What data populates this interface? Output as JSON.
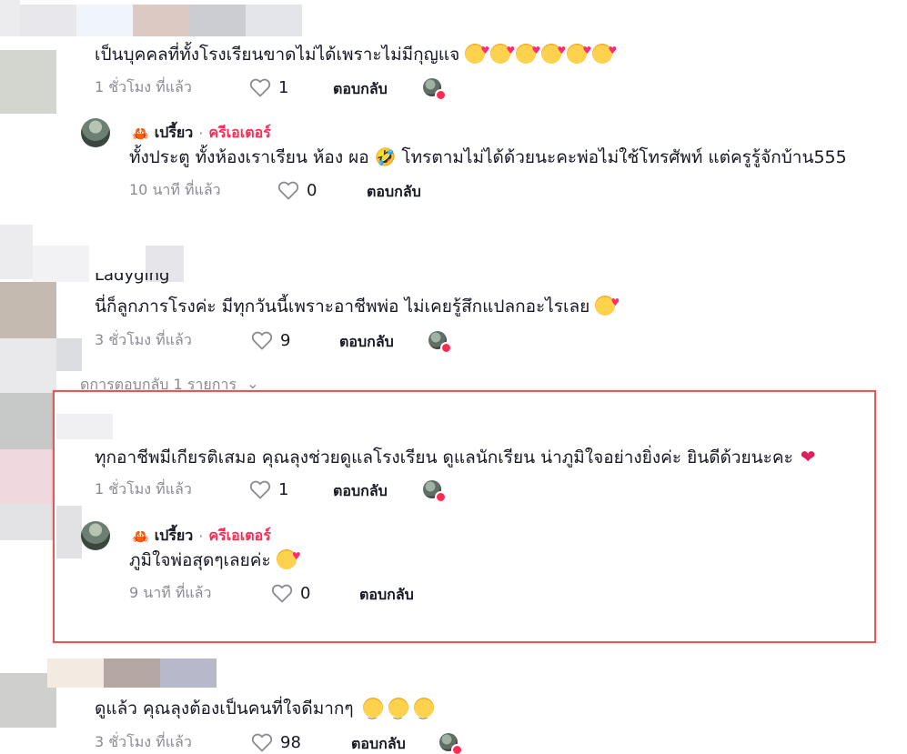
{
  "comments": [
    {
      "text": "เป็นบุคคลที่ทั้งโรงเรียนขาดไม่ได้เพราะไม่มีกุญแจ",
      "emojis": [
        "love",
        "love",
        "love",
        "love",
        "love",
        "love"
      ],
      "time": "1 ชั่วโมง ที่แล้ว",
      "likes": "1",
      "reply_label": "ตอบกลับ"
    },
    {
      "author_prefix": "🦀",
      "author": "เปรี้ยว",
      "separator": "·",
      "role": "ครีเอเตอร์",
      "text": "ทั้งประตู ทั้งห้องเราเรียน ห้อง ผอ 🤣 โทรตามไม่ได้ด้วยนะคะพ่อไม่ใช้โทรศัพท์ แต่ครูรู้จักบ้าน555",
      "time": "10 นาที ที่แล้ว",
      "likes": "0",
      "reply_label": "ตอบกลับ"
    },
    {
      "author_partial": "Ladyging",
      "text": "นี่ก็ลูกภารโรงค่ะ มีทุกวันนี้เพราะอาชีพพ่อ ไม่เคยรู้สึกแปลกอะไรเลย",
      "time": "3 ชั่วโมง ที่แล้ว",
      "likes": "9",
      "reply_label": "ตอบกลับ",
      "view_replies": "ดูการตอบกลับ 1 รายการ"
    },
    {
      "text": "ทุกอาชีพมีเกียรติเสมอ คุณลุงช่วยดูแลโรงเรียน ดูแลนักเรียน น่าภูมิใจอย่างยิ่งค่ะ ยินดีด้วยนะคะ",
      "time": "1 ชั่วโมง ที่แล้ว",
      "likes": "1",
      "reply_label": "ตอบกลับ"
    },
    {
      "author_prefix": "🦀",
      "author": "เปรี้ยว",
      "separator": "·",
      "role": "ครีเอเตอร์",
      "text": "ภูมิใจพ่อสุดๆเลยค่ะ",
      "time": "9 นาที ที่แล้ว",
      "likes": "0",
      "reply_label": "ตอบกลับ"
    },
    {
      "text": "ดูแล้ว คุณลุงต้องเป็นคนที่ใจดีมากๆ",
      "time": "3 ชั่วโมง ที่แล้ว",
      "likes": "98",
      "reply_label": "ตอบกลับ"
    }
  ],
  "colors": {
    "creator_accent": "#fe2c55",
    "highlight_border": "#e05a5a",
    "meta_gray": "#8a8b91"
  },
  "icons": {
    "like": "heart-outline-icon",
    "creator_liked": "creator-liked-badge-icon"
  }
}
